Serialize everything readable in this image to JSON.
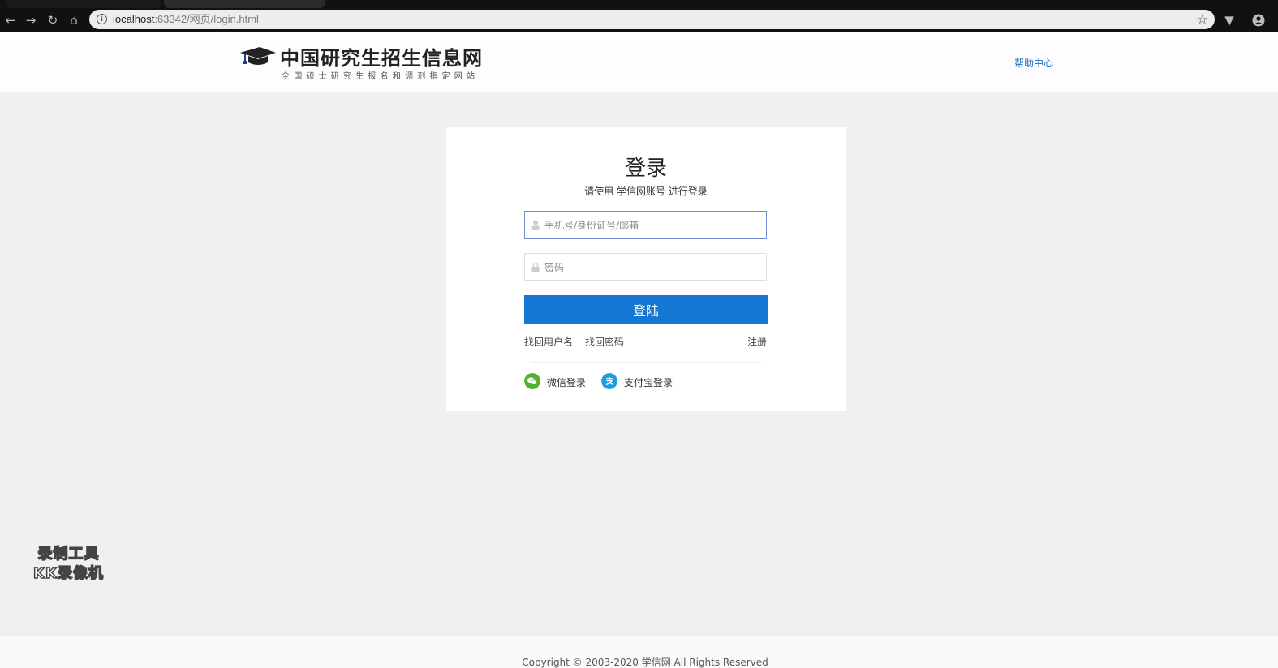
{
  "browser": {
    "url_host": "localhost",
    "url_path": ":63342/网页/login.html"
  },
  "header": {
    "logo_title": "中国研究生招生信息网",
    "logo_subtitle": "全国硕士研究生报名和调剂指定网站",
    "help_link": "帮助中心"
  },
  "login": {
    "title": "登录",
    "subtitle": "请使用 学信网账号 进行登录",
    "username_placeholder": "手机号/身份证号/邮箱",
    "password_placeholder": "密码",
    "submit_label": "登陆",
    "recover_username": "找回用户名",
    "recover_password": "找回密码",
    "register": "注册",
    "wechat_login": "微信登录",
    "alipay_login": "支付宝登录"
  },
  "watermark": {
    "line1": "录制工具",
    "line2": "KK录像机"
  },
  "footer": {
    "copyright": "Copyright © 2003-2020 学信网 All Rights Reserved"
  },
  "colors": {
    "primary": "#1577d4",
    "link": "#1a6fc4",
    "wechat": "#51b12f",
    "alipay": "#1a9fe0",
    "background": "#eff0f0"
  },
  "icons": [
    "back-arrow-icon",
    "forward-arrow-icon",
    "reload-icon",
    "home-icon",
    "info-icon",
    "star-icon",
    "extension-icon",
    "account-icon",
    "graduation-cap-icon",
    "user-icon",
    "lock-icon",
    "wechat-icon",
    "alipay-icon"
  ]
}
